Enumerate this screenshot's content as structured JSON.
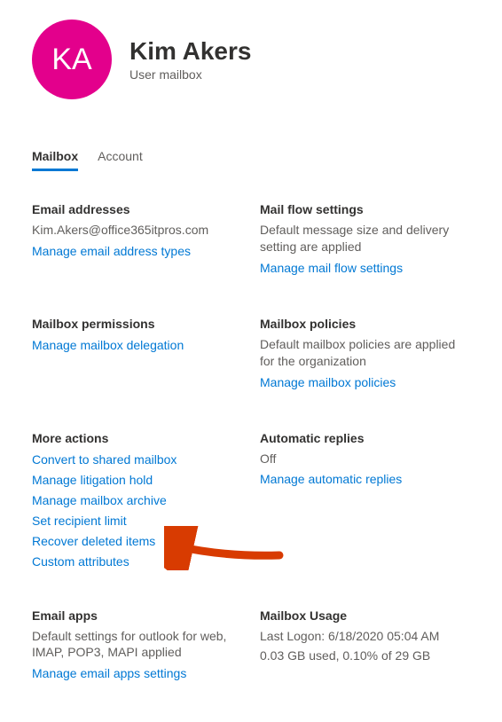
{
  "avatar": {
    "initials": "KA"
  },
  "header": {
    "name": "Kim Akers",
    "subtitle": "User mailbox"
  },
  "tabs": [
    {
      "label": "Mailbox",
      "active": true
    },
    {
      "label": "Account",
      "active": false
    }
  ],
  "email": {
    "heading": "Email addresses",
    "value": "Kim.Akers@office365itpros.com",
    "link": "Manage email address types"
  },
  "mailflow": {
    "heading": "Mail flow settings",
    "desc": "Default message size and delivery setting are applied",
    "link": "Manage mail flow settings"
  },
  "permissions": {
    "heading": "Mailbox permissions",
    "link": "Manage mailbox delegation"
  },
  "policies": {
    "heading": "Mailbox policies",
    "desc": "Default mailbox policies are applied for the organization",
    "link": "Manage mailbox policies"
  },
  "moreActions": {
    "heading": "More actions",
    "items": [
      "Convert to shared mailbox",
      "Manage litigation hold",
      "Manage mailbox archive",
      "Set recipient limit",
      "Recover deleted items",
      "Custom attributes"
    ]
  },
  "autoReplies": {
    "heading": "Automatic replies",
    "status": "Off",
    "link": "Manage automatic replies"
  },
  "emailApps": {
    "heading": "Email apps",
    "desc": "Default settings for outlook for web, IMAP, POP3, MAPI applied",
    "link": "Manage email apps settings"
  },
  "usage": {
    "heading": "Mailbox Usage",
    "logon": "Last Logon: 6/18/2020 05:04 AM",
    "used": "0.03 GB used, 0.10% of 29 GB"
  }
}
